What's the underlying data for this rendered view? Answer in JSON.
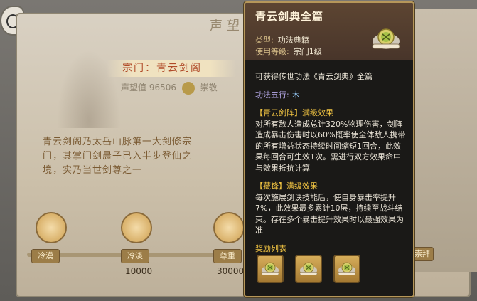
{
  "background": {
    "scroll_title": "声望",
    "sect_label": "宗门：青云剑阁",
    "reputation_label": "声望值",
    "reputation_value": "96506",
    "reputation_rank": "崇敬",
    "description": "青云剑阁乃太岳山脉第一大剑修宗门，其掌门剑晨子已入半步登仙之境，实乃当世剑尊之一",
    "milestones": [
      {
        "label": "冷漠",
        "value": ""
      },
      {
        "label": "冷淡",
        "value": "10000"
      },
      {
        "label": "尊重",
        "value": "30000"
      }
    ],
    "right_tag": "崇拜"
  },
  "tooltip": {
    "title": "青云剑典全篇",
    "type_label": "类型:",
    "type_value": "功法典籍",
    "level_label": "使用等级:",
    "level_value": "宗门1级",
    "acquire_text": "可获得传世功法《青云剑典》全篇",
    "element_label": "功法五行:",
    "element_value": "木",
    "effects": [
      {
        "title": "【青云剑阵】满级效果",
        "text": "对所有敌人造成总计320%物理伤害，剑阵造成暴击伤害时以60%概率使全体敌人携带的所有增益状态持续时间缩短1回合，此效果每回合可生效1次。需进行双方效果命中与效果抵抗计算"
      },
      {
        "title": "【藏锋】满级效果",
        "text": "每次施展剑诀技能后，使自身暴击率提升7%，此效果最多累计10层，持续至战斗结束。存在多个暴击提升效果时以最强效果为准"
      }
    ],
    "rewards_label": "奖励列表",
    "reward_icons": [
      "scroll-icon",
      "scroll-icon",
      "scroll-icon"
    ]
  },
  "colors": {
    "tooltip_bg": "#1a1917",
    "tooltip_border": "#b6975a",
    "effect_title": "#f0c342",
    "element_value": "#9ad0ff"
  }
}
